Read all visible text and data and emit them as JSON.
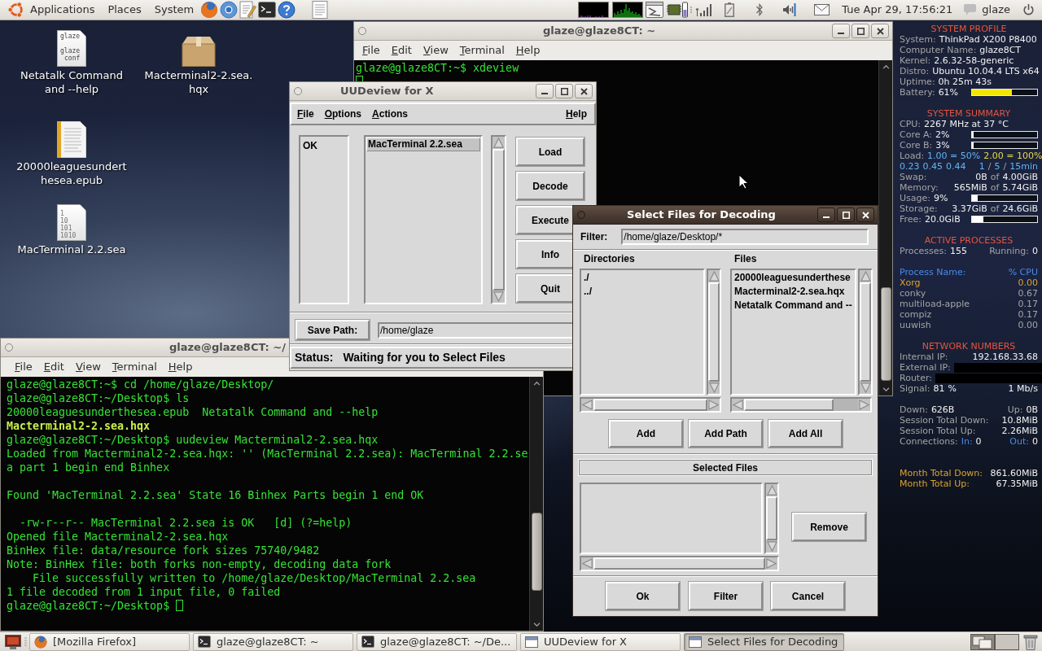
{
  "top_panel": {
    "menus": [
      "Applications",
      "Places",
      "System"
    ],
    "clock": "Tue Apr 29, 17:56:21",
    "user": "glaze"
  },
  "desktop_icons": [
    {
      "kind": "text-file",
      "label": "Netatalk Command and --help",
      "preview": [
        "glaze",
        "glaze",
        "conf"
      ]
    },
    {
      "kind": "package",
      "label": "Macterminal2-2.sea.\nhqx"
    },
    {
      "kind": "ebook",
      "label": "20000leaguesundert\nhesea.epub"
    },
    {
      "kind": "binary",
      "label": "MacTerminal 2.2.sea",
      "preview": [
        "1",
        "10",
        "101",
        "1010"
      ]
    }
  ],
  "terminal_top": {
    "title": "glaze@glaze8CT: ~",
    "menus": [
      "File",
      "Edit",
      "View",
      "Terminal",
      "Help"
    ],
    "lines": [
      {
        "kind": "plain",
        "text": "glaze@glaze8CT:~$ xdeview"
      },
      {
        "kind": "cursor"
      }
    ]
  },
  "uudeview": {
    "title": "UUDeview for X",
    "menus": [
      "File",
      "Options",
      "Actions",
      "Help"
    ],
    "status_list": [
      "OK"
    ],
    "files": [
      {
        "name": "MacTerminal 2.2.sea",
        "selected": true
      }
    ],
    "buttons": [
      "Load",
      "Decode",
      "Execute",
      "Info",
      "Quit"
    ],
    "save_path_button": "Save Path:",
    "save_path": "/home/glaze",
    "status_label": "Status:",
    "status": "Waiting for you to Select Files"
  },
  "conky": {
    "sections": [
      {
        "heading": "SYSTEM PROFILE",
        "rows": [
          {
            "kind": "text",
            "left": [
              {
                "text": "System:",
                "kind": "label"
              },
              {
                "text": "ThinkPad X200 P8400",
                "kind": "value"
              }
            ]
          },
          {
            "kind": "text",
            "left": [
              {
                "text": "Computer Name:",
                "kind": "label"
              },
              {
                "text": "glaze8CT",
                "kind": "value"
              }
            ]
          },
          {
            "kind": "text",
            "left": [
              {
                "text": "Kernel:",
                "kind": "label"
              },
              {
                "text": "2.6.32-58-generic",
                "kind": "value"
              }
            ]
          },
          {
            "kind": "text",
            "left": [
              {
                "text": "Distro:",
                "kind": "label"
              },
              {
                "text": "Ubuntu 10.04.4 LTS x64",
                "kind": "value"
              }
            ]
          },
          {
            "kind": "text",
            "left": [
              {
                "text": "Uptime:",
                "kind": "label"
              },
              {
                "text": "0h 25m 43s",
                "kind": "value"
              }
            ]
          },
          {
            "kind": "bar",
            "left": [
              {
                "text": "Battery:",
                "kind": "label"
              },
              {
                "text": "61%",
                "kind": "value"
              }
            ],
            "level": 0.61,
            "color": "#f2e600"
          }
        ]
      },
      {
        "heading": "SYSTEM SUMMARY",
        "rows": [
          {
            "kind": "text",
            "left": [
              {
                "text": "CPU:",
                "kind": "label"
              },
              {
                "text": "2267 MHz at 37 °C",
                "kind": "value"
              }
            ]
          },
          {
            "kind": "bar",
            "left": [
              {
                "text": "Core A:",
                "kind": "label"
              },
              {
                "text": "2%",
                "kind": "value"
              }
            ],
            "level": 0.02,
            "color": "#ffffff"
          },
          {
            "kind": "bar",
            "left": [
              {
                "text": "Core B:",
                "kind": "label"
              },
              {
                "text": "3%",
                "kind": "value"
              }
            ],
            "level": 0.03,
            "color": "#ffffff"
          },
          {
            "kind": "text",
            "left": [
              {
                "text": "Load:",
                "kind": "label"
              },
              {
                "text": "1.00 = 50%",
                "kind": "blue"
              },
              {
                "text": "2.00 = 100%",
                "kind": "yellow"
              }
            ]
          },
          {
            "kind": "text",
            "left": [
              {
                "text": "0.23",
                "kind": "blue"
              },
              {
                "text": "0.45",
                "kind": "blue"
              },
              {
                "text": "0.44",
                "kind": "blue"
              }
            ],
            "right": [
              {
                "text": "1",
                "kind": "blue"
              },
              {
                "text": "/",
                "kind": "label"
              },
              {
                "text": "5",
                "kind": "blue"
              },
              {
                "text": "/",
                "kind": "label"
              },
              {
                "text": "15min",
                "kind": "blue"
              }
            ]
          },
          {
            "kind": "text",
            "left": [
              {
                "text": "Swap:",
                "kind": "label"
              }
            ],
            "right": [
              {
                "text": "0B",
                "kind": "value"
              },
              {
                "text": "of",
                "kind": "label"
              },
              {
                "text": "4.00GiB",
                "kind": "value"
              }
            ]
          },
          {
            "kind": "text",
            "left": [
              {
                "text": "Memory:",
                "kind": "label"
              }
            ],
            "right": [
              {
                "text": "565MiB",
                "kind": "value"
              },
              {
                "text": "of",
                "kind": "label"
              },
              {
                "text": "5.74GiB",
                "kind": "value"
              }
            ]
          },
          {
            "kind": "bar",
            "left": [
              {
                "text": "Usage:",
                "kind": "label"
              },
              {
                "text": "9%",
                "kind": "value"
              }
            ],
            "level": 0.09,
            "color": "#ffffff"
          },
          {
            "kind": "text",
            "left": [
              {
                "text": "Storage:",
                "kind": "label"
              }
            ],
            "right": [
              {
                "text": "3.37GiB",
                "kind": "value"
              },
              {
                "text": "of",
                "kind": "label"
              },
              {
                "text": "24.6GiB",
                "kind": "value"
              }
            ]
          },
          {
            "kind": "bar",
            "left": [
              {
                "text": "Free:",
                "kind": "label"
              },
              {
                "text": "20.0GiB",
                "kind": "value"
              }
            ],
            "level": 0.18,
            "color": "#ffffff"
          }
        ]
      },
      {
        "heading": "ACTIVE PROCESSES",
        "rows": [
          {
            "kind": "text",
            "left": [
              {
                "text": "Processes:",
                "kind": "label"
              },
              {
                "text": "155",
                "kind": "value"
              }
            ],
            "right": [
              {
                "text": "Running:",
                "kind": "label"
              },
              {
                "text": "0",
                "kind": "value"
              }
            ]
          },
          {
            "kind": "gap"
          },
          {
            "kind": "text",
            "left": [
              {
                "text": "Process Name:",
                "kind": "darkblue"
              }
            ],
            "right": [
              {
                "text": "% CPU",
                "kind": "darkblue"
              }
            ]
          },
          {
            "kind": "text",
            "left": [
              {
                "text": "Xorg",
                "kind": "orange"
              }
            ],
            "right": [
              {
                "text": "0.00",
                "kind": "orange"
              }
            ]
          },
          {
            "kind": "text",
            "left": [
              {
                "text": "conky",
                "kind": "label"
              }
            ],
            "right": [
              {
                "text": "0.67",
                "kind": "label"
              }
            ]
          },
          {
            "kind": "text",
            "left": [
              {
                "text": "multiload-apple",
                "kind": "label"
              }
            ],
            "right": [
              {
                "text": "0.17",
                "kind": "label"
              }
            ]
          },
          {
            "kind": "text",
            "left": [
              {
                "text": "compiz",
                "kind": "label"
              }
            ],
            "right": [
              {
                "text": "0.17",
                "kind": "label"
              }
            ]
          },
          {
            "kind": "text",
            "left": [
              {
                "text": "uuwish",
                "kind": "label"
              }
            ],
            "right": [
              {
                "text": "0.00",
                "kind": "label"
              }
            ]
          }
        ]
      },
      {
        "heading": "NETWORK NUMBERS",
        "rows": [
          {
            "kind": "text",
            "left": [
              {
                "text": "Internal IP:",
                "kind": "label"
              }
            ],
            "right": [
              {
                "text": "192.168.33.68",
                "kind": "value"
              }
            ]
          },
          {
            "kind": "redacted",
            "left": [
              {
                "text": "External IP:",
                "kind": "label"
              }
            ]
          },
          {
            "kind": "redacted",
            "left": [
              {
                "text": "Router:",
                "kind": "label"
              }
            ]
          },
          {
            "kind": "text",
            "left": [
              {
                "text": "Signal:",
                "kind": "label"
              },
              {
                "text": "81",
                "kind": "value"
              },
              {
                "text": "%",
                "kind": "value"
              }
            ],
            "right": [
              {
                "text": "1 Mb/s",
                "kind": "value"
              }
            ]
          },
          {
            "kind": "gap"
          },
          {
            "kind": "text",
            "left": [
              {
                "text": "Down:",
                "kind": "label"
              },
              {
                "text": "626B",
                "kind": "value"
              }
            ],
            "right": [
              {
                "text": "Up:",
                "kind": "label"
              },
              {
                "text": "0B",
                "kind": "value"
              }
            ]
          },
          {
            "kind": "text",
            "left": [
              {
                "text": "Session Total Down:",
                "kind": "label"
              }
            ],
            "right": [
              {
                "text": "10.8MiB",
                "kind": "value"
              }
            ]
          },
          {
            "kind": "text",
            "left": [
              {
                "text": "Session Total Up:",
                "kind": "label"
              }
            ],
            "right": [
              {
                "text": "2.26MiB",
                "kind": "value"
              }
            ]
          },
          {
            "kind": "text",
            "left": [
              {
                "text": "Connections:",
                "kind": "label"
              },
              {
                "text": "In:",
                "kind": "darkblue"
              },
              {
                "text": "0",
                "kind": "value"
              }
            ],
            "right": [
              {
                "text": "Out:",
                "kind": "darkblue"
              },
              {
                "text": "0",
                "kind": "value"
              }
            ]
          },
          {
            "kind": "gap"
          },
          {
            "kind": "gap"
          },
          {
            "kind": "text",
            "left": [
              {
                "text": "Month Total Down:",
                "kind": "orange"
              }
            ],
            "right": [
              {
                "text": "861.60MiB",
                "kind": "value"
              }
            ]
          },
          {
            "kind": "text",
            "left": [
              {
                "text": "Month Total Up:",
                "kind": "orange"
              }
            ],
            "right": [
              {
                "text": "67.35MiB",
                "kind": "value"
              }
            ]
          }
        ]
      }
    ]
  },
  "terminal_bottom": {
    "title": "glaze@glaze8CT: ~/",
    "menus": [
      "File",
      "Edit",
      "View",
      "Terminal",
      "Help"
    ],
    "lines": [
      {
        "kind": "plain",
        "text": "glaze@glaze8CT:~$ cd /home/glaze/Desktop/"
      },
      {
        "kind": "plain",
        "text": "glaze@glaze8CT:~/Desktop$ ls"
      },
      {
        "kind": "plain",
        "text": "20000leaguesunderthesea.epub  Netatalk Command and --help"
      },
      {
        "kind": "bold",
        "text": "Macterminal2-2.sea.hqx"
      },
      {
        "kind": "plain",
        "text": "glaze@glaze8CT:~/Desktop$ uudeview Macterminal2-2.sea.hqx"
      },
      {
        "kind": "plain",
        "text": "Loaded from Macterminal2-2.sea.hqx: '' (MacTerminal 2.2.sea): MacTerminal 2.2.se"
      },
      {
        "kind": "plain",
        "text": "a part 1 begin end Binhex"
      },
      {
        "kind": "blank"
      },
      {
        "kind": "plain",
        "text": "Found 'MacTerminal 2.2.sea' State 16 Binhex Parts begin 1 end OK"
      },
      {
        "kind": "blank"
      },
      {
        "kind": "indented",
        "text": "-rw-r--r-- MacTerminal 2.2.sea is OK   [d] (?=help)"
      },
      {
        "kind": "plain",
        "text": "Opened file Macterminal2-2.sea.hqx"
      },
      {
        "kind": "plain",
        "text": "BinHex file: data/resource fork sizes 75740/9482"
      },
      {
        "kind": "plain",
        "text": "Note: BinHex file: both forks non-empty, decoding data fork"
      },
      {
        "kind": "deep",
        "text": "File successfully written to /home/glaze/Desktop/MacTerminal 2.2.sea"
      },
      {
        "kind": "plain",
        "text": "1 file decoded from 1 input file, 0 failed"
      },
      {
        "kind": "prompt",
        "text": "glaze@glaze8CT:~/Desktop$"
      }
    ]
  },
  "select_dialog": {
    "title": "Select Files for Decoding",
    "filter_label": "Filter:",
    "filter": "/home/glaze/Desktop/*",
    "directories_label": "Directories",
    "files_label": "Files",
    "directories": [
      {
        "name": "./",
        "selected": false
      },
      {
        "name": "../",
        "selected": false
      }
    ],
    "files": [
      {
        "name": "20000leaguesunderthese",
        "selected": false
      },
      {
        "name": "Macterminal2-2.sea.hqx",
        "selected": false
      },
      {
        "name": "Netatalk Command and --",
        "selected": false
      }
    ],
    "add_buttons": [
      "Add",
      "Add Path",
      "Add All"
    ],
    "selected_files_label": "Selected Files",
    "remove_button": "Remove",
    "buttons": [
      "Ok",
      "Filter",
      "Cancel"
    ]
  },
  "taskbar": {
    "items": [
      {
        "label": "[Mozilla Firefox]",
        "kind": "browser",
        "selected": false
      },
      {
        "label": "glaze@glaze8CT: ~",
        "kind": "terminal",
        "selected": false
      },
      {
        "label": "glaze@glaze8CT: ~/De...",
        "kind": "terminal",
        "selected": false
      },
      {
        "label": "UUDeview for X",
        "kind": "window",
        "selected": false
      },
      {
        "label": "Select Files for Decoding",
        "kind": "window",
        "selected": true
      }
    ]
  }
}
